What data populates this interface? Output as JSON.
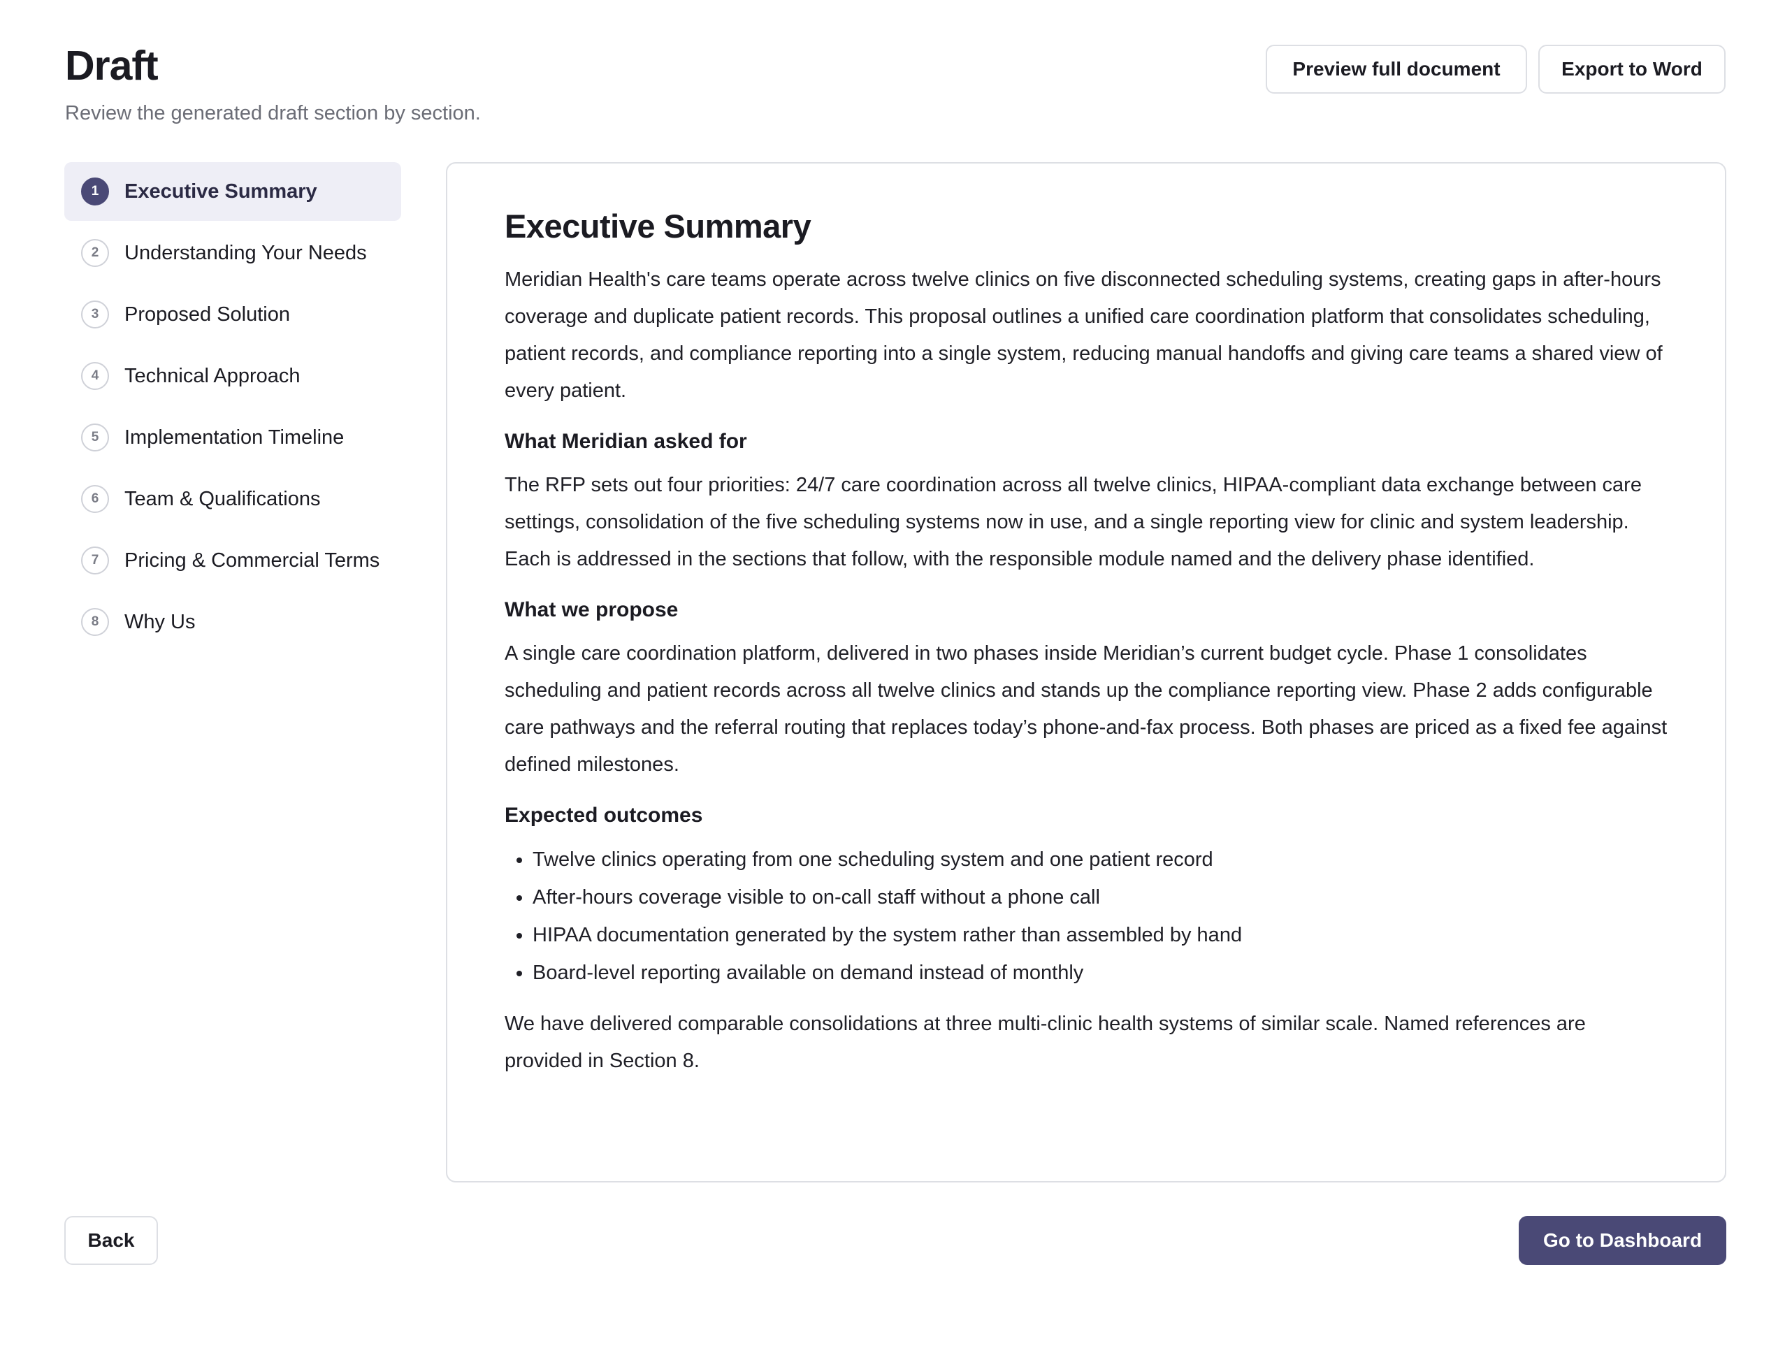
{
  "header": {
    "title": "Draft",
    "subtitle": "Review the generated draft section by section."
  },
  "toolbar": {
    "preview_label": "Preview full document",
    "export_label": "Export to Word"
  },
  "sidebar": {
    "items": [
      {
        "number": "1",
        "label": "Executive Summary",
        "active": true
      },
      {
        "number": "2",
        "label": "Understanding Your Needs",
        "active": false
      },
      {
        "number": "3",
        "label": "Proposed Solution",
        "active": false
      },
      {
        "number": "4",
        "label": "Technical Approach",
        "active": false
      },
      {
        "number": "5",
        "label": "Implementation Timeline",
        "active": false
      },
      {
        "number": "6",
        "label": "Team & Qualifications",
        "active": false
      },
      {
        "number": "7",
        "label": "Pricing & Commercial Terms",
        "active": false
      },
      {
        "number": "8",
        "label": "Why Us",
        "active": false
      }
    ]
  },
  "document": {
    "title": "Executive Summary",
    "intro": "Meridian Health's care teams operate across twelve clinics on five disconnected scheduling systems, creating gaps in after-hours coverage and duplicate patient records. This proposal outlines a unified care coordination platform that consolidates scheduling, patient records, and compliance reporting into a single system, reducing manual handoffs and giving care teams a shared view of every patient.",
    "sections": [
      {
        "heading": "What Meridian asked for",
        "body": "The RFP sets out four priorities: 24/7 care coordination across all twelve clinics, HIPAA-compliant data exchange between care settings, consolidation of the five scheduling systems now in use, and a single reporting view for clinic and system leadership. Each is addressed in the sections that follow, with the responsible module named and the delivery phase identified."
      },
      {
        "heading": "What we propose",
        "body": "A single care coordination platform, delivered in two phases inside Meridian’s current budget cycle. Phase 1 consolidates scheduling and patient records across all twelve clinics and stands up the compliance reporting view. Phase 2 adds configurable care pathways and the referral routing that replaces today’s phone-and-fax process. Both phases are priced as a fixed fee against defined milestones."
      }
    ],
    "outcomes_heading": "Expected outcomes",
    "outcomes": [
      "Twelve clinics operating from one scheduling system and one patient record",
      "After-hours coverage visible to on-call staff without a phone call",
      "HIPAA documentation generated by the system rather than assembled by hand",
      "Board-level reporting available on demand instead of monthly"
    ],
    "closing": "We have delivered comparable consolidations at three multi-clinic health systems of similar scale. Named references are provided in Section 8."
  },
  "footer": {
    "back_label": "Back",
    "dashboard_label": "Go to Dashboard"
  },
  "colors": {
    "accent": "#4a4976",
    "active_bg": "#eeeef6",
    "border": "#dddfe4",
    "muted_text": "#6b6d76"
  }
}
